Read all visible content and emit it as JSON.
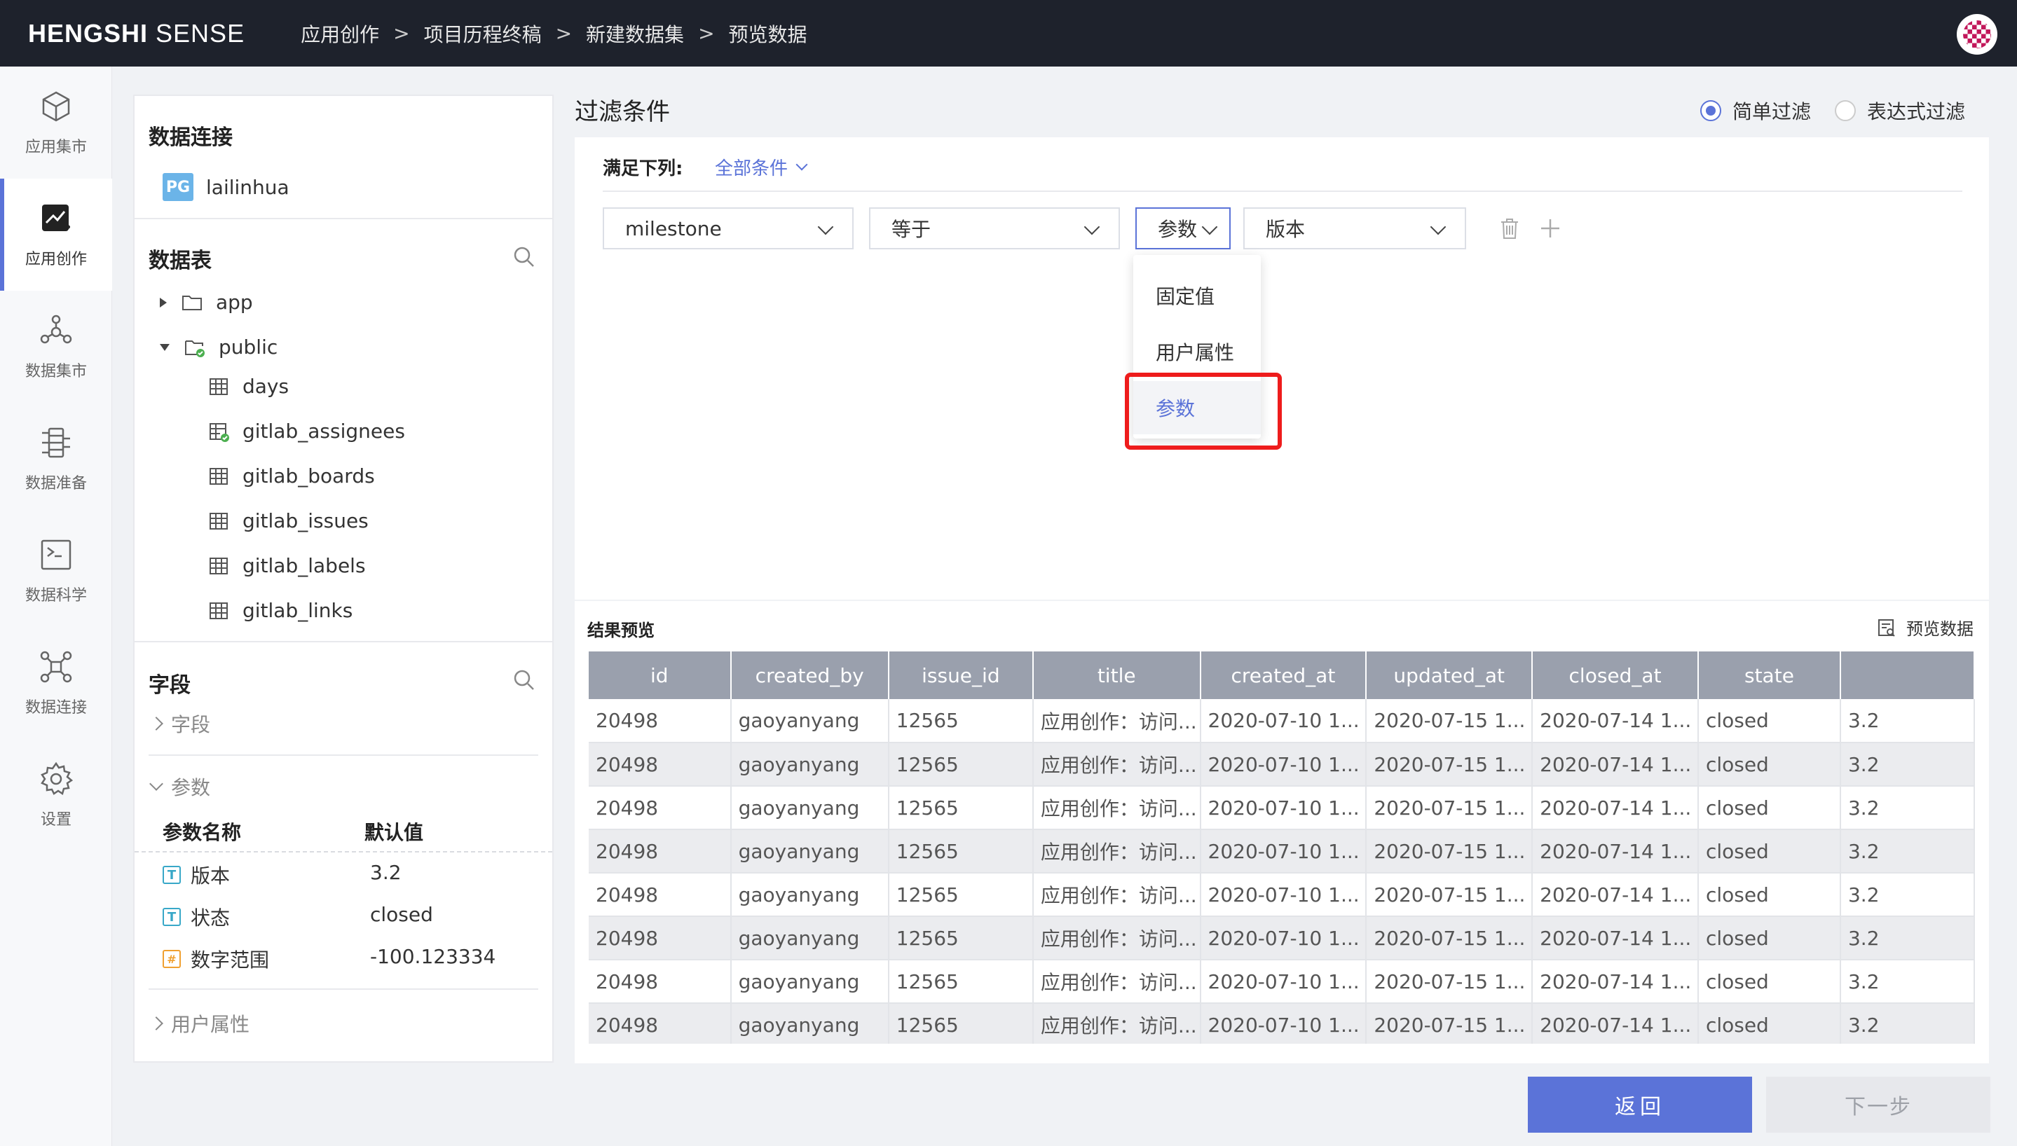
{
  "topbar": {
    "brand_bold": "HENGSHI",
    "brand_light": " SENSE",
    "breadcrumb": [
      "应用创作",
      "项目历程终稿",
      "新建数据集",
      "预览数据"
    ],
    "separator": ">"
  },
  "leftnav": [
    {
      "label": "应用集市",
      "icon": "cube-icon"
    },
    {
      "label": "应用创作",
      "icon": "chart-edit-icon",
      "active": true
    },
    {
      "label": "数据集市",
      "icon": "hexagon-network-icon"
    },
    {
      "label": "数据准备",
      "icon": "data-prep-icon"
    },
    {
      "label": "数据科学",
      "icon": "terminal-icon"
    },
    {
      "label": "数据连接",
      "icon": "connection-icon"
    },
    {
      "label": "设置",
      "icon": "gear-icon"
    }
  ],
  "left_panel": {
    "connection_title": "数据连接",
    "connection_badge": "PG",
    "connection_name": "lailinhua",
    "tables_title": "数据表",
    "tree": [
      {
        "label": "app",
        "type": "folder",
        "expanded": false
      },
      {
        "label": "public",
        "type": "folder",
        "expanded": true
      },
      {
        "label": "days",
        "type": "table"
      },
      {
        "label": "gitlab_assignees",
        "type": "table-checked"
      },
      {
        "label": "gitlab_boards",
        "type": "table"
      },
      {
        "label": "gitlab_issues",
        "type": "table"
      },
      {
        "label": "gitlab_labels",
        "type": "table"
      },
      {
        "label": "gitlab_links",
        "type": "table"
      }
    ],
    "fields_title": "字段",
    "fields_section": "字段",
    "params_section": "参数",
    "param_col_name": "参数名称",
    "param_col_default": "默认值",
    "params": [
      {
        "badge": "T",
        "name": "版本",
        "value": "3.2"
      },
      {
        "badge": "T",
        "name": "状态",
        "value": "closed"
      },
      {
        "badge": "#",
        "name": "数字范围",
        "value": "-100.123334"
      }
    ],
    "user_attr_section": "用户属性"
  },
  "filter": {
    "title": "过滤条件",
    "mode_simple": "简单过滤",
    "mode_expr": "表达式过滤",
    "satisfy_label": "满足下列:",
    "satisfy_value": "全部条件",
    "field_select": "milestone",
    "operator_select": "等于",
    "value_type_select": "参数",
    "value_select": "版本",
    "dropdown_options": [
      "固定值",
      "用户属性",
      "参数"
    ]
  },
  "result": {
    "title": "结果预览",
    "preview_label": "预览数据",
    "columns": [
      "id",
      "created_by",
      "issue_id",
      "title",
      "created_at",
      "updated_at",
      "closed_at",
      "state",
      ""
    ],
    "rows": [
      [
        "20498",
        "gaoyanyang",
        "12565",
        "应用创作：访问...",
        "2020-07-10 1...",
        "2020-07-15 1...",
        "2020-07-14 1...",
        "closed",
        "3.2"
      ],
      [
        "20498",
        "gaoyanyang",
        "12565",
        "应用创作：访问...",
        "2020-07-10 1...",
        "2020-07-15 1...",
        "2020-07-14 1...",
        "closed",
        "3.2"
      ],
      [
        "20498",
        "gaoyanyang",
        "12565",
        "应用创作：访问...",
        "2020-07-10 1...",
        "2020-07-15 1...",
        "2020-07-14 1...",
        "closed",
        "3.2"
      ],
      [
        "20498",
        "gaoyanyang",
        "12565",
        "应用创作：访问...",
        "2020-07-10 1...",
        "2020-07-15 1...",
        "2020-07-14 1...",
        "closed",
        "3.2"
      ],
      [
        "20498",
        "gaoyanyang",
        "12565",
        "应用创作：访问...",
        "2020-07-10 1...",
        "2020-07-15 1...",
        "2020-07-14 1...",
        "closed",
        "3.2"
      ],
      [
        "20498",
        "gaoyanyang",
        "12565",
        "应用创作：访问...",
        "2020-07-10 1...",
        "2020-07-15 1...",
        "2020-07-14 1...",
        "closed",
        "3.2"
      ],
      [
        "20498",
        "gaoyanyang",
        "12565",
        "应用创作：访问...",
        "2020-07-10 1...",
        "2020-07-15 1...",
        "2020-07-14 1...",
        "closed",
        "3.2"
      ],
      [
        "20498",
        "gaoyanyang",
        "12565",
        "应用创作：访问...",
        "2020-07-10 1...",
        "2020-07-15 1...",
        "2020-07-14 1...",
        "closed",
        "3.2"
      ]
    ]
  },
  "footer": {
    "back_label": "返回",
    "next_label": "下一步"
  },
  "colors": {
    "accent": "#5b73d8",
    "topbar_bg": "#1e222c",
    "highlight": "#ee1c1c"
  }
}
